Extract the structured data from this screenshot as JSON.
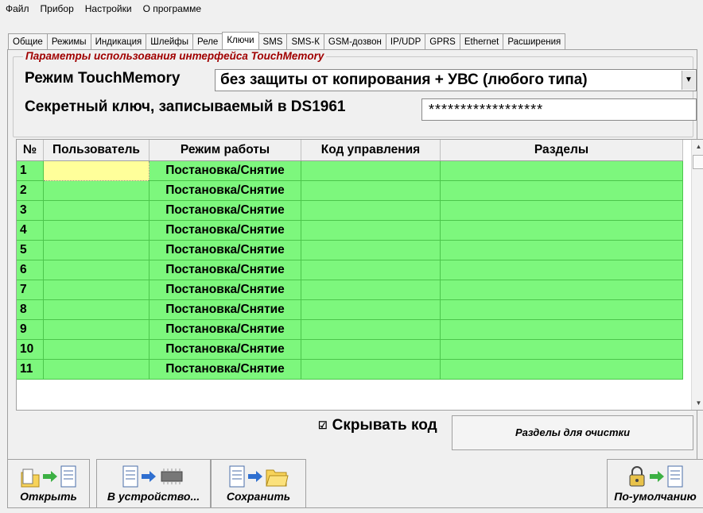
{
  "menu": [
    "Файл",
    "Прибор",
    "Настройки",
    "О программе"
  ],
  "tabs": [
    "Общие",
    "Режимы",
    "Индикация",
    "Шлейфы",
    "Реле",
    "Ключи",
    "SMS",
    "SMS-К",
    "GSM-дозвон",
    "IP/UDP",
    "GPRS",
    "Ethernet",
    "Расширения"
  ],
  "active_tab": "Ключи",
  "group": {
    "title": "Параметры использования интерфейса TouchMemory",
    "mode_label": "Режим TouchMemory",
    "mode_value": "без защиты от копирования + УВС (любого типа)",
    "secret_label": "Секретный ключ, записываемый в DS1961",
    "secret_value": "******************"
  },
  "table": {
    "headers": [
      "№",
      "Пользователь",
      "Режим работы",
      "Код управления",
      "Разделы"
    ],
    "rows": [
      {
        "num": "1",
        "mode": "Постановка/Снятие"
      },
      {
        "num": "2",
        "mode": "Постановка/Снятие"
      },
      {
        "num": "3",
        "mode": "Постановка/Снятие"
      },
      {
        "num": "4",
        "mode": "Постановка/Снятие"
      },
      {
        "num": "5",
        "mode": "Постановка/Снятие"
      },
      {
        "num": "6",
        "mode": "Постановка/Снятие"
      },
      {
        "num": "7",
        "mode": "Постановка/Снятие"
      },
      {
        "num": "8",
        "mode": "Постановка/Снятие"
      },
      {
        "num": "9",
        "mode": "Постановка/Снятие"
      },
      {
        "num": "10",
        "mode": "Постановка/Снятие"
      },
      {
        "num": "11",
        "mode": "Постановка/Снятие"
      }
    ]
  },
  "hide_code": {
    "label": "Скрывать код",
    "checked": true
  },
  "parts_clear_button": "Разделы для очистки",
  "toolbar": {
    "open": "Открыть",
    "to_device": "В устройство...",
    "save": "Сохранить",
    "defaults": "По-умолчанию"
  },
  "colors": {
    "row_green": "#7df77d",
    "title_red": "#a00000",
    "selected_cell": "#ffff9a"
  }
}
